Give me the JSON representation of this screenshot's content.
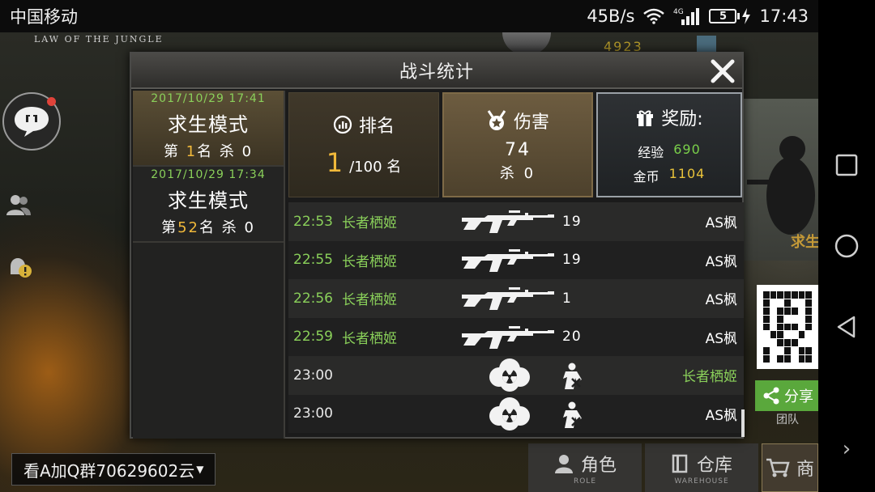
{
  "status_bar": {
    "carrier": "中国移动",
    "speed": "45B/s",
    "network": "4G",
    "battery": "5",
    "time": "17:43"
  },
  "game": {
    "brand": "LAW OF THE JUNGLE",
    "top_coins": "4923",
    "ad_text": "看A加Q群70629602云",
    "right_banner_label": "求生",
    "share_label": "分享",
    "share_sub": "团队",
    "bottom_tabs": [
      {
        "label": "角色",
        "sub": "ROLE",
        "icon": "role-icon"
      },
      {
        "label": "仓库",
        "sub": "WAREHOUSE",
        "icon": "warehouse-icon"
      },
      {
        "label": "商",
        "sub": "",
        "icon": "cart-icon"
      }
    ]
  },
  "modal": {
    "title": "战斗统计",
    "history": [
      {
        "date": "2017/10/29 17:41",
        "mode": "求生模式",
        "rank_prefix": "第",
        "rank": "1",
        "rank_suffix": "名",
        "kills_label": "杀",
        "kills": "0",
        "active": true
      },
      {
        "date": "2017/10/29 17:34",
        "mode": "求生模式",
        "rank_prefix": "第",
        "rank": "52",
        "rank_suffix": "名",
        "kills_label": "杀",
        "kills": "0",
        "active": false
      }
    ],
    "rank_card": {
      "title": "排名",
      "rank": "1",
      "total": "/100 名"
    },
    "damage_card": {
      "title": "伤害",
      "value": "74",
      "kills_text": "杀 0"
    },
    "reward_card": {
      "title": "奖励:",
      "exp_label": "经验",
      "exp_value": "690",
      "gold_label": "金币",
      "gold_value": "1104"
    },
    "events": [
      {
        "time": "22:53",
        "time_color": "green",
        "killer": "长者栖姬",
        "type": "weapon",
        "distance": "19",
        "victim": "AS枫",
        "victim_color": "white"
      },
      {
        "time": "22:55",
        "time_color": "green",
        "killer": "长者栖姬",
        "type": "weapon",
        "distance": "19",
        "victim": "AS枫",
        "victim_color": "white"
      },
      {
        "time": "22:56",
        "time_color": "green",
        "killer": "长者栖姬",
        "type": "weapon",
        "distance": "1",
        "victim": "AS枫",
        "victim_color": "white"
      },
      {
        "time": "22:59",
        "time_color": "green",
        "killer": "长者栖姬",
        "type": "weapon",
        "distance": "20",
        "victim": "AS枫",
        "victim_color": "white"
      },
      {
        "time": "23:00",
        "time_color": "white",
        "killer": "",
        "type": "gas",
        "distance": "",
        "victim": "长者栖姬",
        "victim_color": "green"
      },
      {
        "time": "23:00",
        "time_color": "white",
        "killer": "",
        "type": "gas",
        "distance": "",
        "victim": "AS枫",
        "victim_color": "white"
      }
    ]
  }
}
